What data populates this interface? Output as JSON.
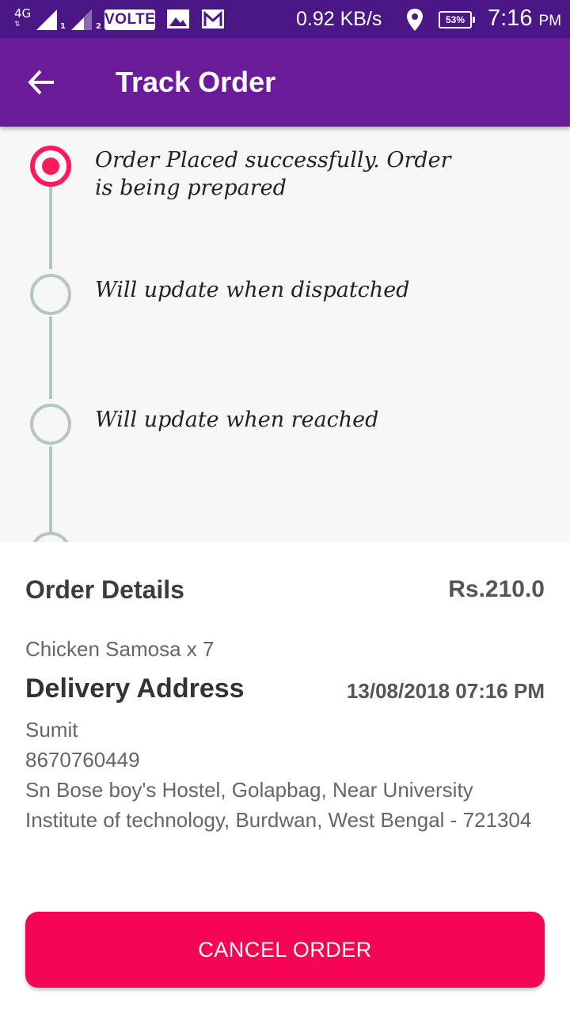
{
  "status_bar": {
    "network_type": "4G",
    "sim1": "1",
    "sim2": "2",
    "volte": "VOLTE",
    "speed": "0.92 KB/s",
    "battery": "53%",
    "time": "7:16",
    "ampm": "PM",
    "icons": [
      "signal-icon",
      "signal-icon",
      "gallery-icon",
      "gmail-icon",
      "location-icon",
      "battery-icon"
    ]
  },
  "app_bar": {
    "title": "Track Order",
    "back_icon": "arrow-left-icon"
  },
  "timeline": {
    "steps": [
      {
        "text": "Order Placed successfully. Order is being prepared",
        "state": "active"
      },
      {
        "text": "Will update when dispatched",
        "state": "pending"
      },
      {
        "text": "Will update when reached",
        "state": "pending"
      }
    ]
  },
  "order_details": {
    "title": "Order Details",
    "amount": "Rs.210.0",
    "item": "Chicken Samosa x 7"
  },
  "delivery": {
    "title": "Delivery Address",
    "date": "13/08/2018 07:16 PM",
    "name": "Sumit",
    "phone": "8670760449",
    "address": "Sn Bose boy's Hostel, Golapbag, Near University Institute of technology, Burdwan, West Bengal - 721304"
  },
  "cancel_button": {
    "label": "CANCEL ORDER"
  },
  "colors": {
    "status_bar": "#4b1787",
    "app_bar": "#6a1b9a",
    "accent": "#f60652",
    "timeline_inactive": "#b5c7bb"
  }
}
